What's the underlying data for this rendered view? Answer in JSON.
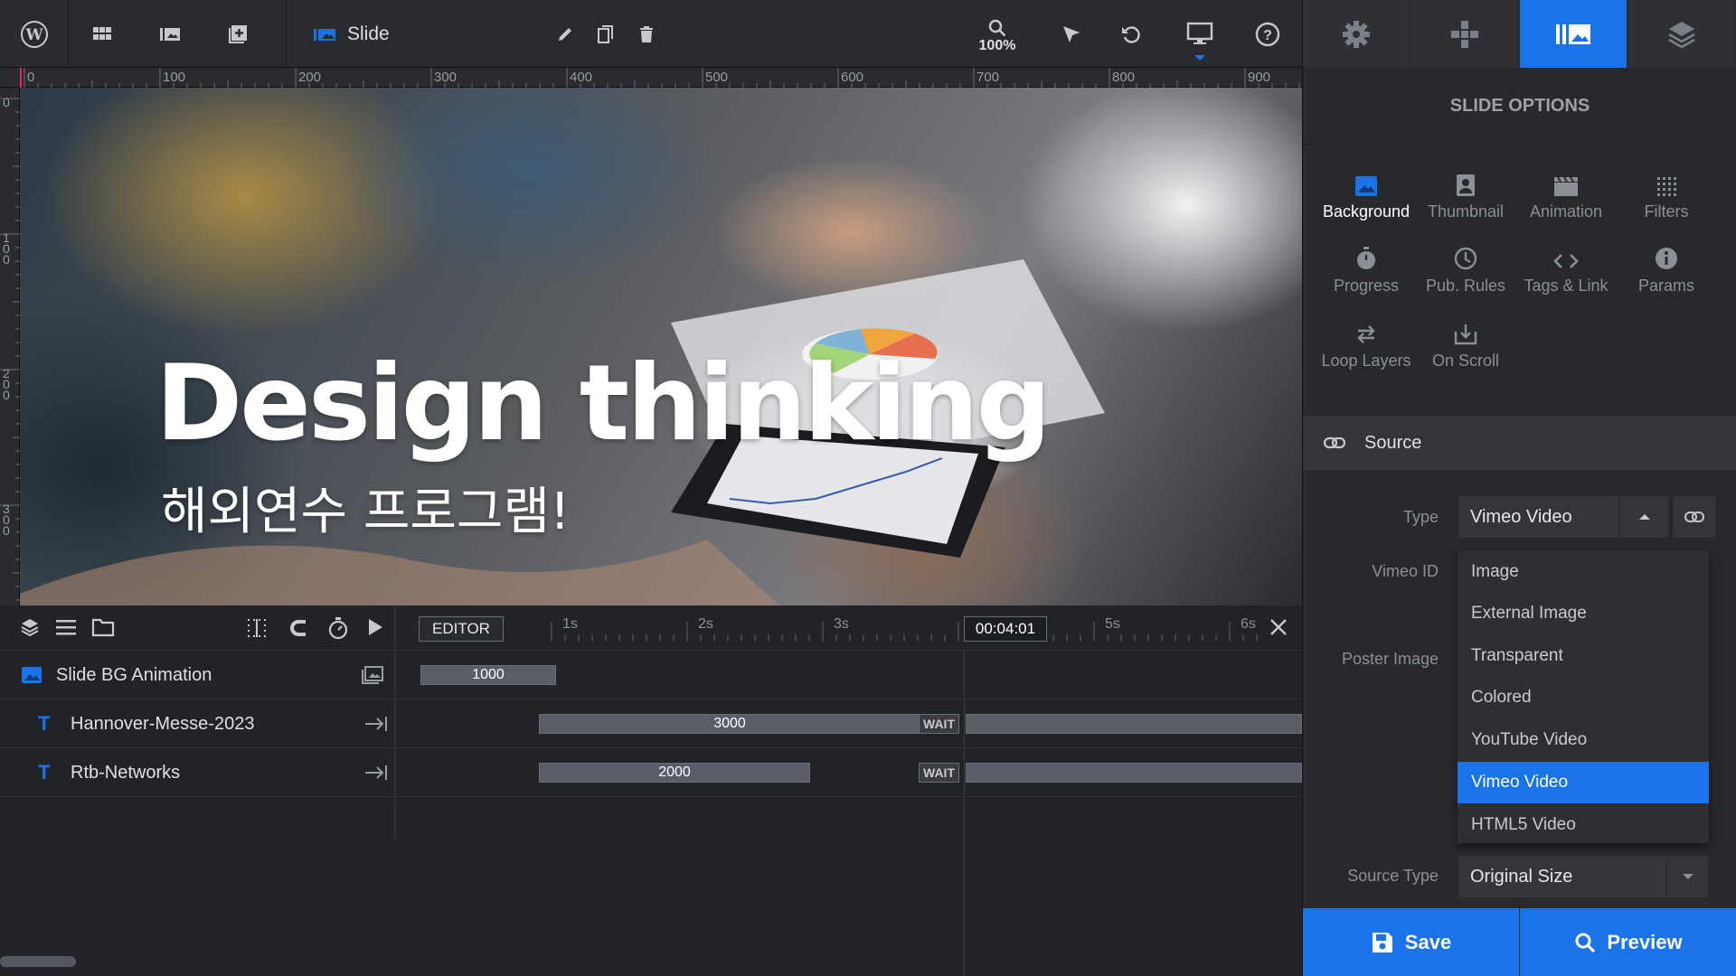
{
  "toolbar": {
    "slide_label": "Slide",
    "zoom": "100%"
  },
  "ruler": {
    "h_labels": [
      "0",
      "100",
      "200",
      "300",
      "400",
      "500",
      "600",
      "700",
      "800",
      "900"
    ],
    "v_labels": [
      "0",
      "100",
      "200",
      "300"
    ]
  },
  "canvas": {
    "headline": "Design thinking",
    "subline": "해외연수 프로그램!"
  },
  "timeline": {
    "editor_label": "EDITOR",
    "time_marks": [
      "1s",
      "2s",
      "3s",
      "5s",
      "6s"
    ],
    "current_time": "00:04:01",
    "rows": [
      {
        "name": "Slide BG Animation",
        "bar_value": "1000"
      },
      {
        "name": "Hannover-Messe-2023",
        "bar_value": "3000",
        "wait": "WAIT"
      },
      {
        "name": "Rtb-Networks",
        "bar_value": "2000",
        "wait": "WAIT"
      }
    ]
  },
  "panel": {
    "title": "SLIDE OPTIONS",
    "options": [
      {
        "label": "Background",
        "icon": "image-icon"
      },
      {
        "label": "Thumbnail",
        "icon": "portrait-icon"
      },
      {
        "label": "Animation",
        "icon": "clapper-icon"
      },
      {
        "label": "Filters",
        "icon": "grid-dots-icon"
      },
      {
        "label": "Progress",
        "icon": "stopwatch-icon"
      },
      {
        "label": "Pub. Rules",
        "icon": "clock-icon"
      },
      {
        "label": "Tags & Link",
        "icon": "code-icon"
      },
      {
        "label": "Params",
        "icon": "info-icon"
      },
      {
        "label": "Loop Layers",
        "icon": "loop-icon"
      },
      {
        "label": "On Scroll",
        "icon": "download-icon"
      }
    ],
    "section_title": "Source",
    "type_label": "Type",
    "type_value": "Vimeo Video",
    "vimeo_id_label": "Vimeo ID",
    "poster_label": "Poster Image",
    "dropdown_options": [
      "Image",
      "External Image",
      "Transparent",
      "Colored",
      "YouTube Video",
      "Vimeo Video",
      "HTML5 Video"
    ],
    "dropdown_selected": "Vimeo Video",
    "source_type_label": "Source Type",
    "source_type_value": "Original Size",
    "save_label": "Save",
    "preview_label": "Preview"
  },
  "colors": {
    "accent": "#1a73e8",
    "panel_bg": "#28292d",
    "toolbar_bg": "#2a2b30"
  }
}
